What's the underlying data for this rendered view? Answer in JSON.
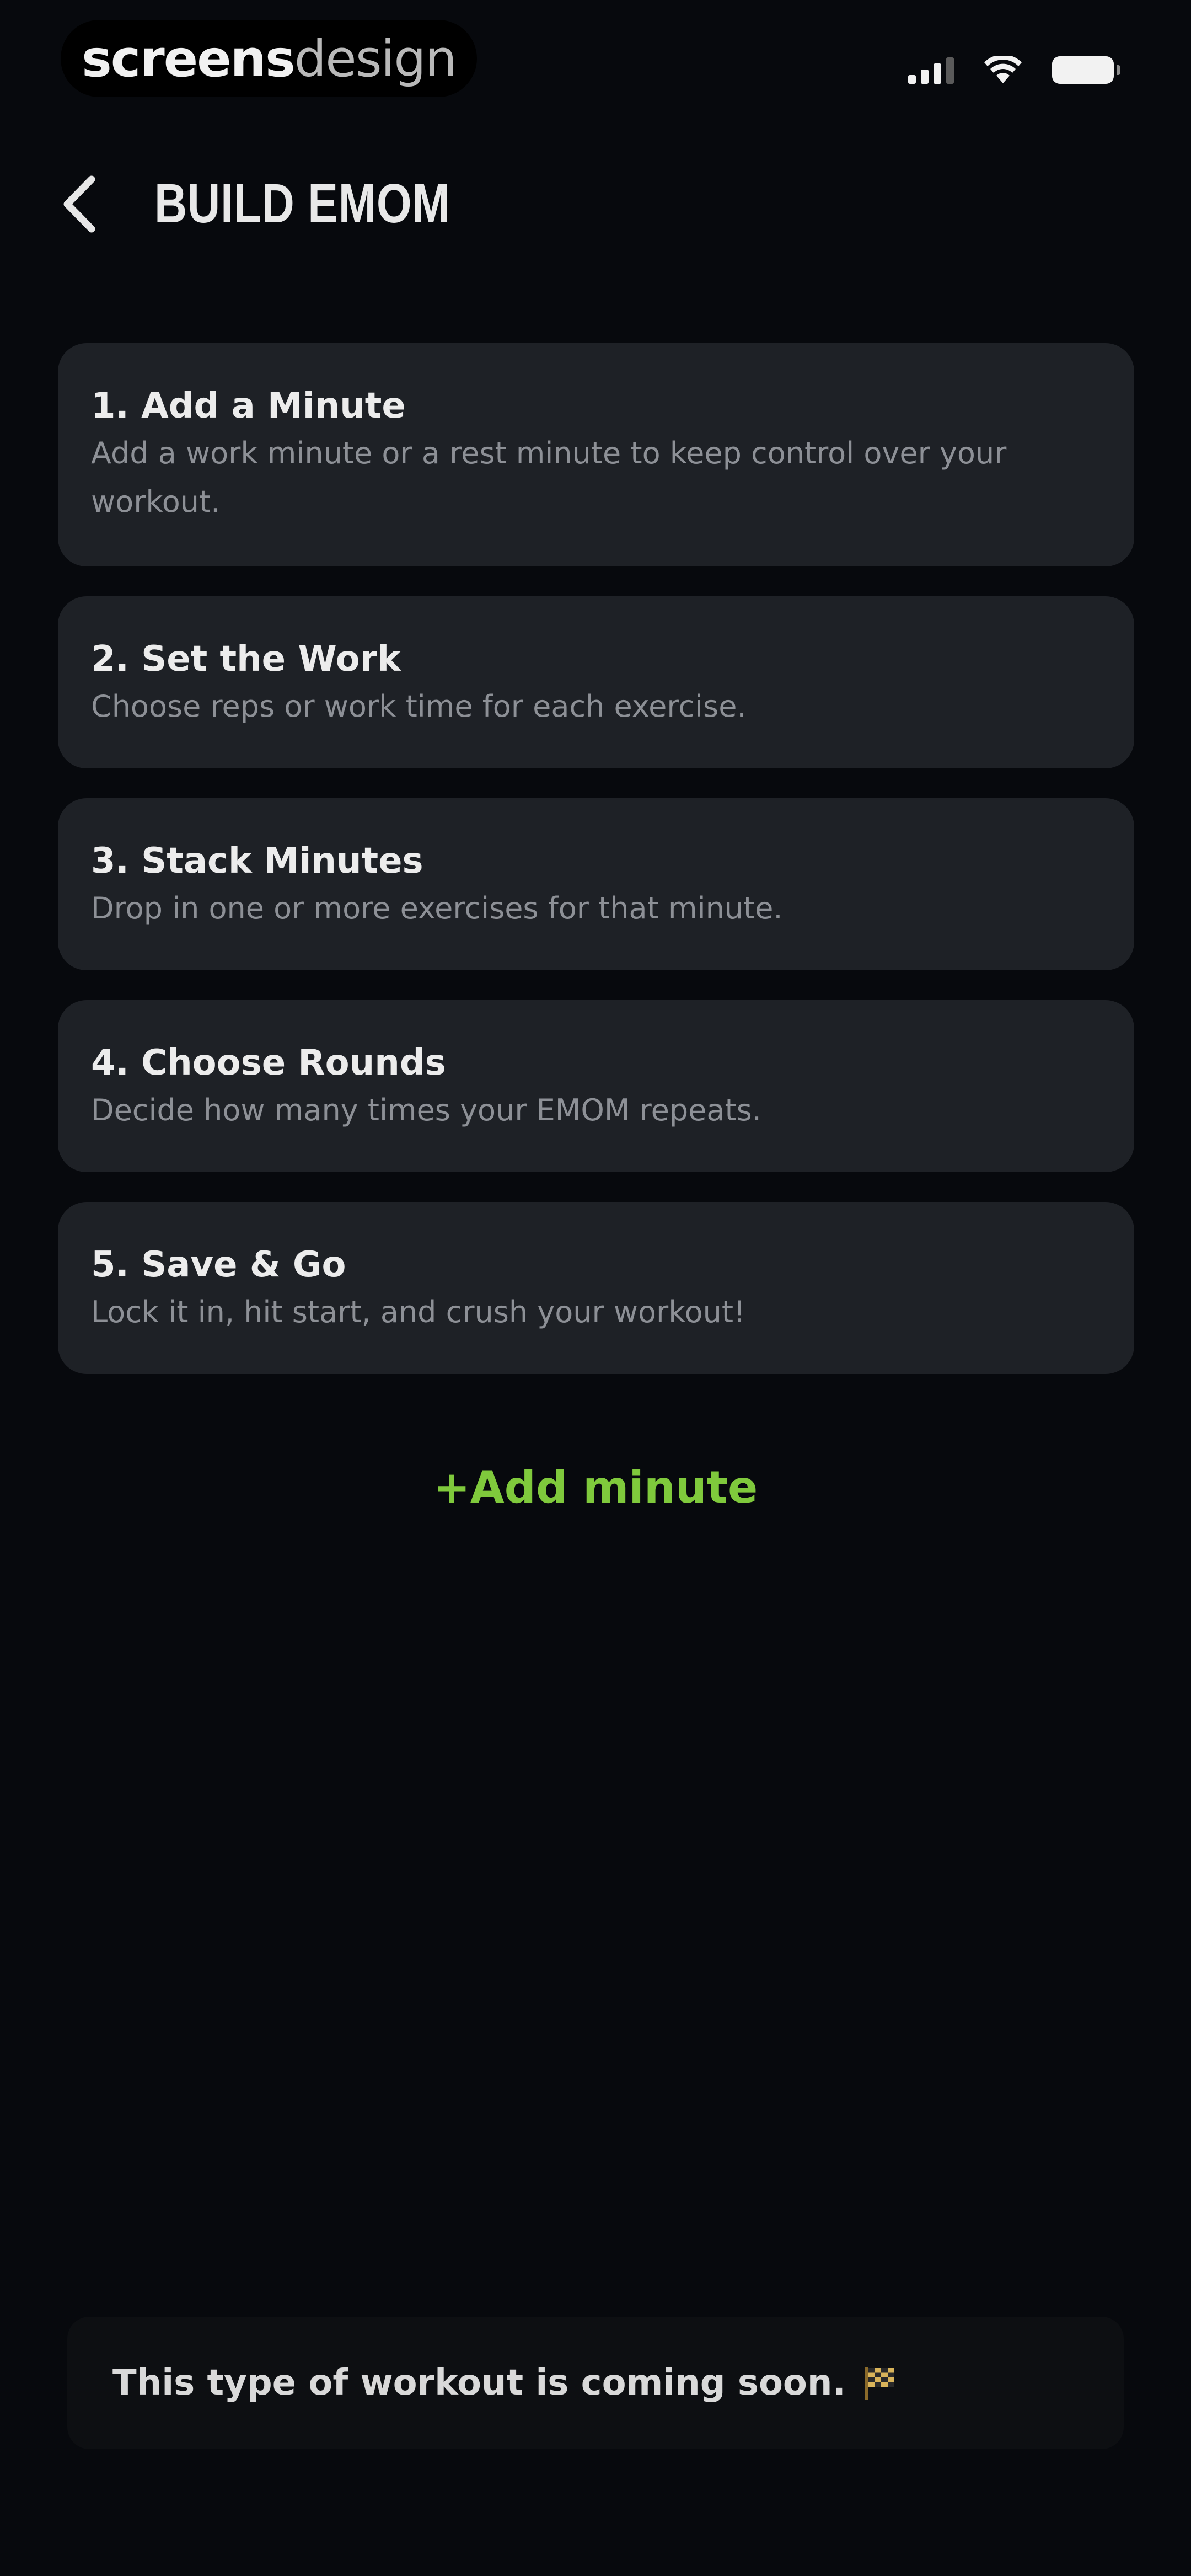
{
  "status_bar": {
    "brand_primary": "screens",
    "brand_secondary": "design",
    "icons": [
      "signal-icon",
      "wifi-icon",
      "battery-icon"
    ]
  },
  "header": {
    "back_icon": "chevron-left-icon",
    "title": "BUILD EMOM"
  },
  "steps": [
    {
      "title": "1. Add a Minute",
      "description": "Add a work minute or a rest minute to keep control over your workout."
    },
    {
      "title": "2. Set the Work",
      "description": "Choose reps or work time for each exercise."
    },
    {
      "title": "3. Stack Minutes",
      "description": "Drop in one or more exercises for that minute."
    },
    {
      "title": "4. Choose Rounds",
      "description": "Decide how many times your EMOM repeats."
    },
    {
      "title": "5. Save & Go",
      "description": "Lock it in, hit start, and crush your workout!"
    }
  ],
  "add_minute": {
    "label": "+Add minute"
  },
  "toast": {
    "message": "This type of workout is coming soon.",
    "icon": "checkered-flag-icon"
  },
  "colors": {
    "background": "#07090d",
    "card": "#1e2126",
    "accent": "#7fc93c",
    "text_primary": "#ececec",
    "text_secondary": "#8d9096"
  }
}
